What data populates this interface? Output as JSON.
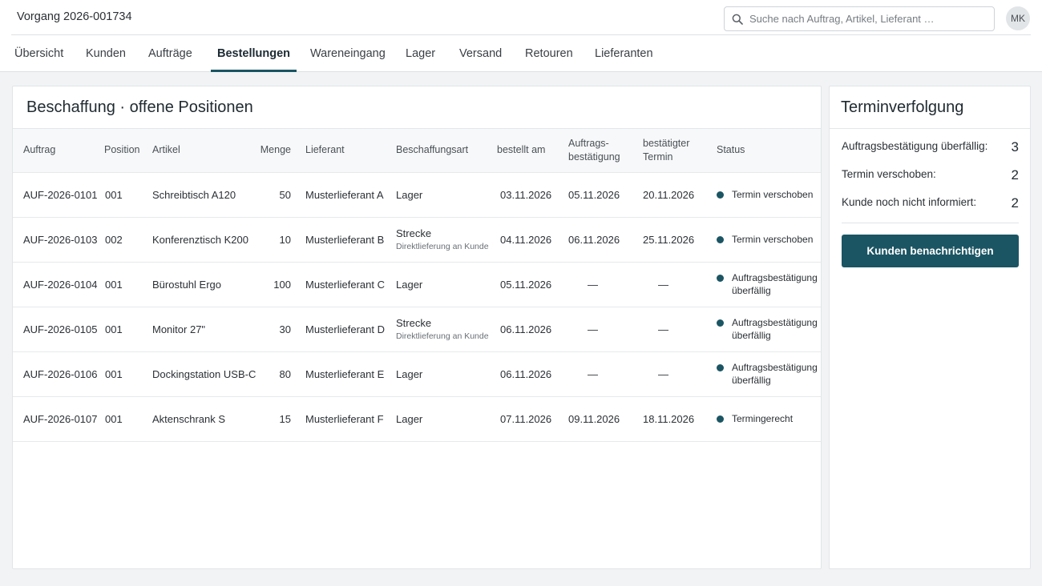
{
  "app": {
    "title": "Vorgang 2026-001734",
    "avatar_initials": "MK"
  },
  "search": {
    "placeholder": "Suche nach Auftrag, Artikel, Lieferant …"
  },
  "nav": {
    "tabs": [
      "Übersicht",
      "Kunden",
      "Aufträge",
      "Bestellungen",
      "Wareneingang",
      "Lager",
      "Versand",
      "Retouren",
      "Lieferanten"
    ],
    "active": "Bestellungen"
  },
  "main": {
    "title": "Beschaffung · offene Positionen",
    "columns": {
      "auftrag": "Auftrag",
      "position": "Position",
      "artikel": "Artikel",
      "menge": "Menge",
      "lieferant": "Lieferant",
      "beschaffungsart": "Beschaffungsart",
      "bestellt_am": "bestellt am",
      "ab_line1": "Auftrags-",
      "ab_line2": "bestätigung",
      "termin_line1": "bestätigter",
      "termin_line2": "Termin",
      "status": "Status"
    },
    "rows": [
      {
        "auftrag": "AUF-2026-0101",
        "position": "001",
        "artikel": "Schreibtisch A120",
        "menge": "50",
        "lieferant": "Musterlieferant A",
        "art": "Lager",
        "art_sub": "",
        "bestellt": "03.11.2026",
        "ab": "05.11.2026",
        "termin": "20.11.2026",
        "status": "Termin verschoben"
      },
      {
        "auftrag": "AUF-2026-0103",
        "position": "002",
        "artikel": "Konferenztisch K200",
        "menge": "10",
        "lieferant": "Musterlieferant B",
        "art": "Strecke",
        "art_sub": "Direktlieferung an Kunde",
        "bestellt": "04.11.2026",
        "ab": "06.11.2026",
        "termin": "25.11.2026",
        "status": "Termin verschoben"
      },
      {
        "auftrag": "AUF-2026-0104",
        "position": "001",
        "artikel": "Bürostuhl Ergo",
        "menge": "100",
        "lieferant": "Musterlieferant C",
        "art": "Lager",
        "art_sub": "",
        "bestellt": "05.11.2026",
        "ab": "—",
        "termin": "—",
        "status": "Auftragsbestätigung überfällig"
      },
      {
        "auftrag": "AUF-2026-0105",
        "position": "001",
        "artikel": "Monitor 27\"",
        "menge": "30",
        "lieferant": "Musterlieferant D",
        "art": "Strecke",
        "art_sub": "Direktlieferung an Kunde",
        "bestellt": "06.11.2026",
        "ab": "—",
        "termin": "—",
        "status": "Auftragsbestätigung überfällig"
      },
      {
        "auftrag": "AUF-2026-0106",
        "position": "001",
        "artikel": "Dockingstation USB-C",
        "menge": "80",
        "lieferant": "Musterlieferant E",
        "art": "Lager",
        "art_sub": "",
        "bestellt": "06.11.2026",
        "ab": "—",
        "termin": "—",
        "status": "Auftragsbestätigung überfällig"
      },
      {
        "auftrag": "AUF-2026-0107",
        "position": "001",
        "artikel": "Aktenschrank S",
        "menge": "15",
        "lieferant": "Musterlieferant F",
        "art": "Lager",
        "art_sub": "",
        "bestellt": "07.11.2026",
        "ab": "09.11.2026",
        "termin": "18.11.2026",
        "status": "Termingerecht"
      }
    ]
  },
  "side": {
    "title": "Terminverfolgung",
    "metrics": [
      {
        "label": "Auftragsbestätigung überfällig:",
        "value": "3"
      },
      {
        "label": "Termin verschoben:",
        "value": "2"
      },
      {
        "label": "Kunde noch nicht informiert:",
        "value": "2"
      }
    ],
    "button": "Kunden benachrichtigen"
  },
  "colors": {
    "accent": "#1b5563",
    "background": "#f1f3f4"
  }
}
